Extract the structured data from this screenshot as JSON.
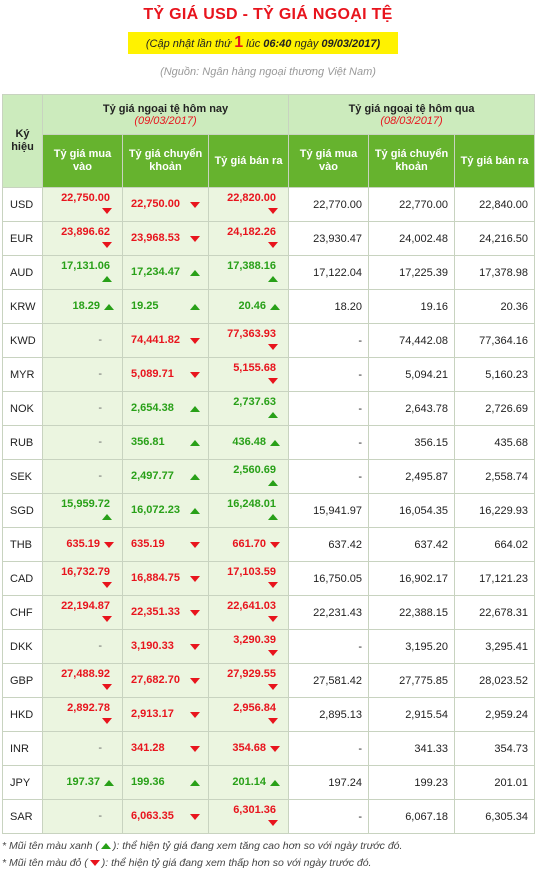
{
  "title": "TỶ GIÁ USD - TỶ GIÁ NGOẠI TỆ",
  "update": {
    "prefix": "(Cập nhật lần thứ",
    "count": "1",
    "mid": "lúc",
    "time": "06:40",
    "mid2": "ngày",
    "date": "09/03/2017)"
  },
  "source": "(Nguồn: Ngân hàng ngoại thương Việt Nam)",
  "header": {
    "symbol": "Ký hiệu",
    "today_label": "Tỷ giá ngoại tệ hôm nay",
    "today_date": "(09/03/2017)",
    "yesterday_label": "Tỷ giá ngoại tệ hôm qua",
    "yesterday_date": "(08/03/2017)",
    "buy": "Tỷ giá mua vào",
    "transfer": "Tỷ giá chuyển khoản",
    "sell": "Tỷ giá bán ra"
  },
  "rows": [
    {
      "code": "USD",
      "buy": "22,750.00",
      "buy_dir": "down",
      "transfer": "22,750.00",
      "transfer_dir": "down",
      "sell": "22,820.00",
      "sell_dir": "down",
      "y_buy": "22,770.00",
      "y_transfer": "22,770.00",
      "y_sell": "22,840.00"
    },
    {
      "code": "EUR",
      "buy": "23,896.62",
      "buy_dir": "down",
      "transfer": "23,968.53",
      "transfer_dir": "down",
      "sell": "24,182.26",
      "sell_dir": "down",
      "y_buy": "23,930.47",
      "y_transfer": "24,002.48",
      "y_sell": "24,216.50"
    },
    {
      "code": "AUD",
      "buy": "17,131.06",
      "buy_dir": "up",
      "transfer": "17,234.47",
      "transfer_dir": "up",
      "sell": "17,388.16",
      "sell_dir": "up",
      "y_buy": "17,122.04",
      "y_transfer": "17,225.39",
      "y_sell": "17,378.98"
    },
    {
      "code": "KRW",
      "buy": "18.29",
      "buy_dir": "up",
      "transfer": "19.25",
      "transfer_dir": "up",
      "sell": "20.46",
      "sell_dir": "up",
      "y_buy": "18.20",
      "y_transfer": "19.16",
      "y_sell": "20.36"
    },
    {
      "code": "KWD",
      "buy": "-",
      "buy_dir": "",
      "transfer": "74,441.82",
      "transfer_dir": "down",
      "sell": "77,363.93",
      "sell_dir": "down",
      "y_buy": "-",
      "y_transfer": "74,442.08",
      "y_sell": "77,364.16"
    },
    {
      "code": "MYR",
      "buy": "-",
      "buy_dir": "",
      "transfer": "5,089.71",
      "transfer_dir": "down",
      "sell": "5,155.68",
      "sell_dir": "down",
      "y_buy": "-",
      "y_transfer": "5,094.21",
      "y_sell": "5,160.23"
    },
    {
      "code": "NOK",
      "buy": "-",
      "buy_dir": "",
      "transfer": "2,654.38",
      "transfer_dir": "up",
      "sell": "2,737.63",
      "sell_dir": "up",
      "y_buy": "-",
      "y_transfer": "2,643.78",
      "y_sell": "2,726.69"
    },
    {
      "code": "RUB",
      "buy": "-",
      "buy_dir": "",
      "transfer": "356.81",
      "transfer_dir": "up",
      "sell": "436.48",
      "sell_dir": "up",
      "y_buy": "-",
      "y_transfer": "356.15",
      "y_sell": "435.68"
    },
    {
      "code": "SEK",
      "buy": "-",
      "buy_dir": "",
      "transfer": "2,497.77",
      "transfer_dir": "up",
      "sell": "2,560.69",
      "sell_dir": "up",
      "y_buy": "-",
      "y_transfer": "2,495.87",
      "y_sell": "2,558.74"
    },
    {
      "code": "SGD",
      "buy": "15,959.72",
      "buy_dir": "up",
      "transfer": "16,072.23",
      "transfer_dir": "up",
      "sell": "16,248.01",
      "sell_dir": "up",
      "y_buy": "15,941.97",
      "y_transfer": "16,054.35",
      "y_sell": "16,229.93"
    },
    {
      "code": "THB",
      "buy": "635.19",
      "buy_dir": "down",
      "transfer": "635.19",
      "transfer_dir": "down",
      "sell": "661.70",
      "sell_dir": "down",
      "y_buy": "637.42",
      "y_transfer": "637.42",
      "y_sell": "664.02"
    },
    {
      "code": "CAD",
      "buy": "16,732.79",
      "buy_dir": "down",
      "transfer": "16,884.75",
      "transfer_dir": "down",
      "sell": "17,103.59",
      "sell_dir": "down",
      "y_buy": "16,750.05",
      "y_transfer": "16,902.17",
      "y_sell": "17,121.23"
    },
    {
      "code": "CHF",
      "buy": "22,194.87",
      "buy_dir": "down",
      "transfer": "22,351.33",
      "transfer_dir": "down",
      "sell": "22,641.03",
      "sell_dir": "down",
      "y_buy": "22,231.43",
      "y_transfer": "22,388.15",
      "y_sell": "22,678.31"
    },
    {
      "code": "DKK",
      "buy": "-",
      "buy_dir": "",
      "transfer": "3,190.33",
      "transfer_dir": "down",
      "sell": "3,290.39",
      "sell_dir": "down",
      "y_buy": "-",
      "y_transfer": "3,195.20",
      "y_sell": "3,295.41"
    },
    {
      "code": "GBP",
      "buy": "27,488.92",
      "buy_dir": "down",
      "transfer": "27,682.70",
      "transfer_dir": "down",
      "sell": "27,929.55",
      "sell_dir": "down",
      "y_buy": "27,581.42",
      "y_transfer": "27,775.85",
      "y_sell": "28,023.52"
    },
    {
      "code": "HKD",
      "buy": "2,892.78",
      "buy_dir": "down",
      "transfer": "2,913.17",
      "transfer_dir": "down",
      "sell": "2,956.84",
      "sell_dir": "down",
      "y_buy": "2,895.13",
      "y_transfer": "2,915.54",
      "y_sell": "2,959.24"
    },
    {
      "code": "INR",
      "buy": "-",
      "buy_dir": "",
      "transfer": "341.28",
      "transfer_dir": "down",
      "sell": "354.68",
      "sell_dir": "down",
      "y_buy": "-",
      "y_transfer": "341.33",
      "y_sell": "354.73"
    },
    {
      "code": "JPY",
      "buy": "197.37",
      "buy_dir": "up",
      "transfer": "199.36",
      "transfer_dir": "up",
      "sell": "201.14",
      "sell_dir": "up",
      "y_buy": "197.24",
      "y_transfer": "199.23",
      "y_sell": "201.01"
    },
    {
      "code": "SAR",
      "buy": "-",
      "buy_dir": "",
      "transfer": "6,063.35",
      "transfer_dir": "down",
      "sell": "6,301.36",
      "sell_dir": "down",
      "y_buy": "-",
      "y_transfer": "6,067.18",
      "y_sell": "6,305.34"
    }
  ],
  "notes": {
    "up_prefix": "* Mũi tên màu xanh (",
    "up_suffix": "): thể hiện tỷ giá đang xem tăng cao hơn so với ngày trước đó.",
    "down_prefix": "* Mũi tên màu đỏ (",
    "down_suffix": "): thể hiện tỷ giá đang xem thấp hơn so với ngày trước đó."
  },
  "colors": {
    "up": "#28a018",
    "down": "#e8141d",
    "header_green": "#66b32e",
    "header_light": "#ccebbd",
    "today_bg": "#ebf5e0"
  }
}
